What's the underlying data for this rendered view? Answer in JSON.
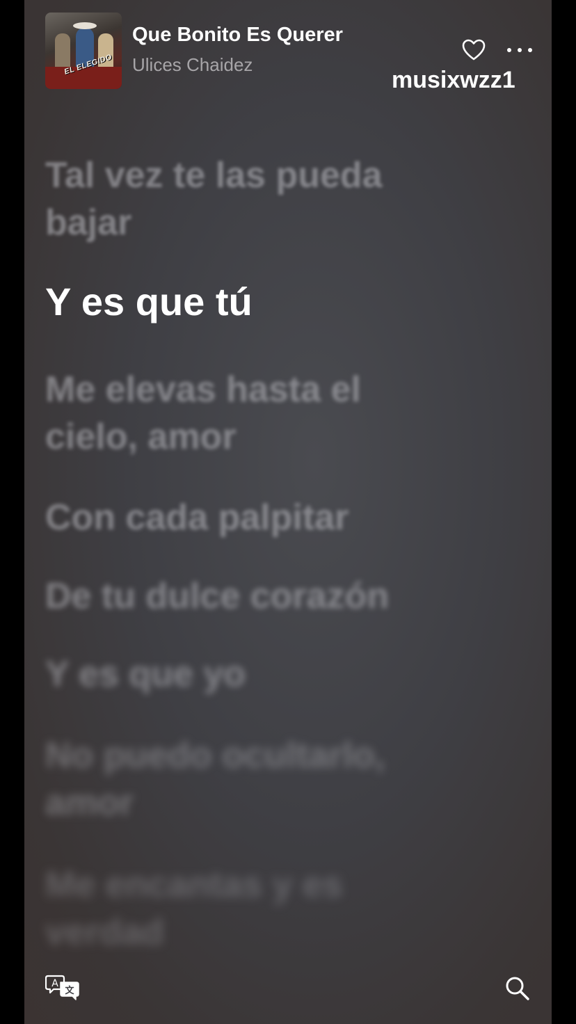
{
  "header": {
    "title": "Que Bonito Es Querer",
    "artist": "Ulices Chaidez",
    "album_art_text": "EL ELEGIDO",
    "favorite_icon": "heart-outline-icon",
    "more_icon": "ellipsis-icon"
  },
  "watermark": "musixwzz1",
  "lyrics": [
    "Tal vez te las pueda bajar",
    "Y es que tú",
    "Me elevas hasta el cielo, amor",
    "Con cada palpitar",
    "De tu dulce corazón",
    "Y es que yo",
    "No puedo ocultarlo, amor",
    "Me encantas y es verdad"
  ],
  "active_lyric_index": 1,
  "footer": {
    "translate_icon": "translate-icon",
    "search_icon": "search-icon"
  },
  "colors": {
    "active_text": "#ffffff",
    "inactive_text": "#bebec3",
    "artist_text": "#a7a5a8",
    "background": "#44444a"
  }
}
